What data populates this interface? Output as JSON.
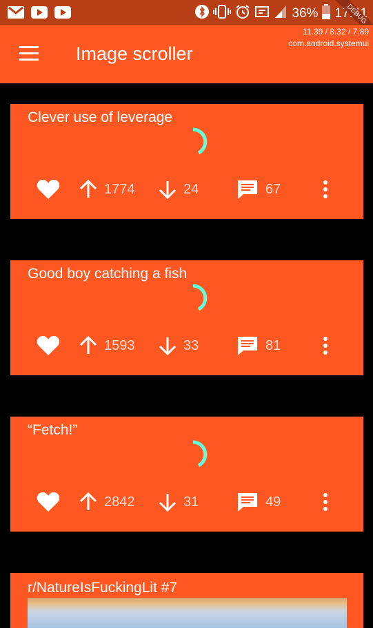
{
  "status_bar": {
    "left_icons": [
      "gmail-icon",
      "youtube-icon",
      "youtube-icon"
    ],
    "battery_percent": "36%",
    "time": "17:41",
    "debug_banner": "DEBUG"
  },
  "perf_overlay": {
    "line1": "11.39 / 8.32 / 7.89",
    "line2": "com.android.systemui"
  },
  "app_bar": {
    "title": "Image scroller"
  },
  "posts": [
    {
      "title": "Clever use of leverage",
      "upvotes": "1774",
      "downvotes": "24",
      "comments": "67"
    },
    {
      "title": "Good boy catching a fish",
      "upvotes": "1593",
      "downvotes": "33",
      "comments": "81"
    },
    {
      "title": "“Fetch!”",
      "upvotes": "2842",
      "downvotes": "31",
      "comments": "49"
    }
  ],
  "last_post": {
    "title": "r/NatureIsFuckingLit #7"
  },
  "colors": {
    "accent": "#ff5722",
    "status_bar": "#b93f16",
    "spinner": "#64ffda",
    "background": "#000000"
  }
}
